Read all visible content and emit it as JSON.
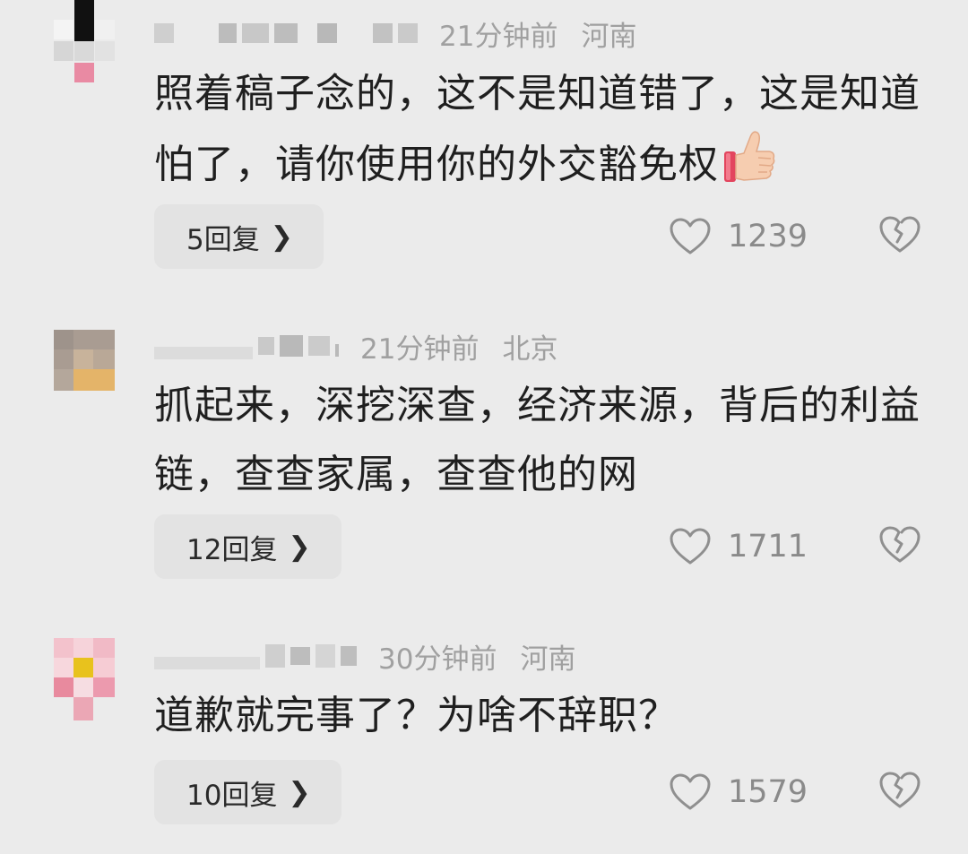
{
  "comments": [
    {
      "time": "21分钟前",
      "location": "河南",
      "text": "照着稿子念的，这不是知道错了，这是知道怕了，请你使用你的外交豁免权",
      "emoji": "thumbs-up-emoji",
      "reply_label": "5回复",
      "likes": "1239"
    },
    {
      "time": "21分钟前",
      "location": "北京",
      "text": "抓起来，深挖深查，经济来源，背后的利益链，查查家属，查查他的网",
      "reply_label": "12回复",
      "likes": "1711"
    },
    {
      "time": "30分钟前",
      "location": "河南",
      "text": "道歉就完事了？为啥不辞职？",
      "reply_label": "10回复",
      "likes": "1579"
    }
  ],
  "icons": {
    "reply_chevron": "chevron-right-icon",
    "like": "heart-outline-icon",
    "dislike": "broken-heart-icon"
  },
  "colors": {
    "background": "#ebebeb",
    "text": "#1f1f1f",
    "meta": "#a0a0a0",
    "count": "#8a8a8a",
    "reply_bg": "#e3e3e3"
  }
}
